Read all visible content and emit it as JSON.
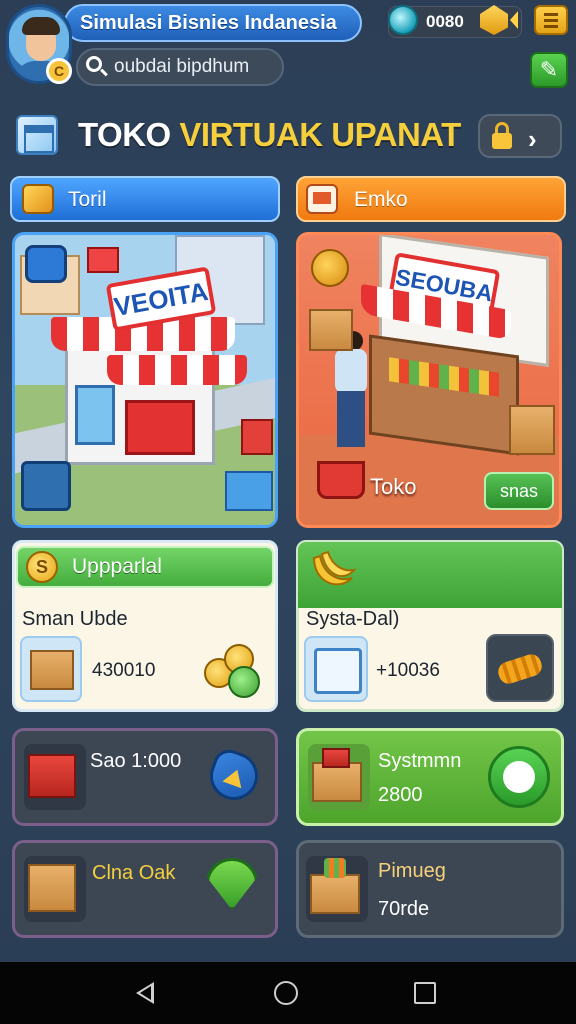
{
  "header": {
    "title": "Simulasi Bisnies Indanesia",
    "search_text": "oubdai bipdhum",
    "currency_value": "0080",
    "avatar_badge": "C"
  },
  "store": {
    "title_part1": "TOKO",
    "title_part2": "VIRTUAK UPANAT"
  },
  "tabs": [
    {
      "label": "Toril",
      "color": "#2f85ea"
    },
    {
      "label": "Emko",
      "color": "#f78b22"
    }
  ],
  "scenes": {
    "left_sign": "VEOITA",
    "right_sign": "SEOUBA",
    "right_label": "Toko",
    "right_button": "snas"
  },
  "cards": {
    "upgrade": {
      "header": "Uppparlal",
      "subtitle": "Sman Ubde",
      "value": "430010",
      "coin_symbol": "S"
    },
    "system": {
      "subtitle": "Systa-Dal)",
      "value": "+10036"
    },
    "card_a": {
      "label": "Sao 1:000"
    },
    "card_b": {
      "label": "Systmmn",
      "value": "2800"
    },
    "card_c": {
      "label": "Clna Oak"
    },
    "card_d": {
      "label": "Pimueg",
      "value": "70rde"
    }
  },
  "icons": [
    "gem-icon",
    "gold-icon",
    "menu-icon",
    "tool-icon",
    "lock-icon",
    "chevron-right-icon",
    "box-icon",
    "coin-icon",
    "banana-icon",
    "screen-icon",
    "roll-icon"
  ]
}
